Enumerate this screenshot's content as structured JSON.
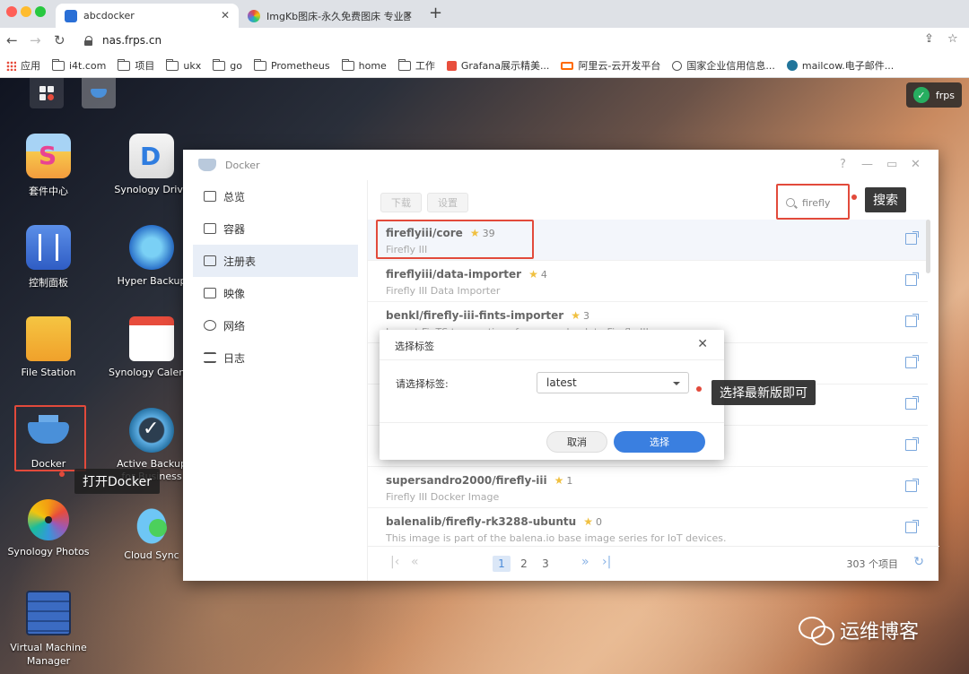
{
  "browser": {
    "tabs": [
      {
        "title": "abcdocker",
        "active": true,
        "favicon": "dsm-icon"
      },
      {
        "title": "ImgKb图床-永久免费图床 专业图",
        "active": false,
        "favicon": "imgkb-icon"
      }
    ],
    "url": "nas.frps.cn",
    "bookmarks": [
      "应用",
      "i4t.com",
      "项目",
      "ukx",
      "go",
      "Prometheus",
      "home",
      "工作",
      "Grafana展示精美...",
      "阿里云-云开发平台",
      "国家企业信用信息...",
      "mailcow.电子邮件..."
    ]
  },
  "desktop": {
    "frps_label": "frps",
    "icons": [
      {
        "label": "套件中心",
        "icon": "package-center-icon"
      },
      {
        "label": "Synology Drive",
        "icon": "synology-drive-icon"
      },
      {
        "label": "控制面板",
        "icon": "control-panel-icon"
      },
      {
        "label": "Hyper Backup",
        "icon": "hyper-backup-icon"
      },
      {
        "label": "File Station",
        "icon": "file-station-icon"
      },
      {
        "label": "Synology Calendar",
        "icon": "calendar-icon"
      },
      {
        "label": "Docker",
        "icon": "docker-icon"
      },
      {
        "label": "Active Backup for Business",
        "icon": "active-backup-icon"
      },
      {
        "label": "Synology Photos",
        "icon": "photos-icon"
      },
      {
        "label": "Cloud Sync",
        "icon": "cloud-sync-icon"
      },
      {
        "label": "Virtual Machine Manager",
        "icon": "vmm-icon"
      }
    ],
    "callouts": {
      "open_docker": "打开Docker",
      "search": "搜索",
      "choose_latest": "选择最新版即可"
    },
    "watermark": "运维博客"
  },
  "docker": {
    "title": "Docker",
    "window_controls": [
      "?",
      "—",
      "▭",
      "✕"
    ],
    "sidebar": [
      {
        "label": "总览",
        "active": false
      },
      {
        "label": "容器",
        "active": false
      },
      {
        "label": "注册表",
        "active": true
      },
      {
        "label": "映像",
        "active": false
      },
      {
        "label": "网络",
        "active": false
      },
      {
        "label": "日志",
        "active": false
      }
    ],
    "toolbar": {
      "download": "下载",
      "settings": "设置",
      "search_value": "firefly"
    },
    "results": [
      {
        "name": "fireflyiii/core",
        "stars": "39",
        "desc": "Firefly III"
      },
      {
        "name": "fireflyiii/data-importer",
        "stars": "4",
        "desc": "Firefly III Data Importer"
      },
      {
        "name": "benkl/firefly-iii-fints-importer",
        "stars": "3",
        "desc": "Import FinTS transactions from your bank to Firefly III."
      },
      {
        "name": "",
        "stars": "",
        "desc": ""
      },
      {
        "name": "",
        "stars": "",
        "desc": ""
      },
      {
        "name": "",
        "stars": "",
        "desc": ""
      },
      {
        "name": "supersandro2000/firefly-iii",
        "stars": "1",
        "desc": "Firefly III Docker Image"
      },
      {
        "name": "balenalib/firefly-rk3288-ubuntu",
        "stars": "0",
        "desc": "This image is part of the balena.io base image series for IoT devices."
      }
    ],
    "pager": {
      "pages": [
        "1",
        "2",
        "3"
      ],
      "current": "1",
      "total": "303 个项目"
    }
  },
  "dialog": {
    "title": "选择标签",
    "label": "请选择标签:",
    "selected": "latest",
    "cancel": "取消",
    "ok": "选择"
  }
}
